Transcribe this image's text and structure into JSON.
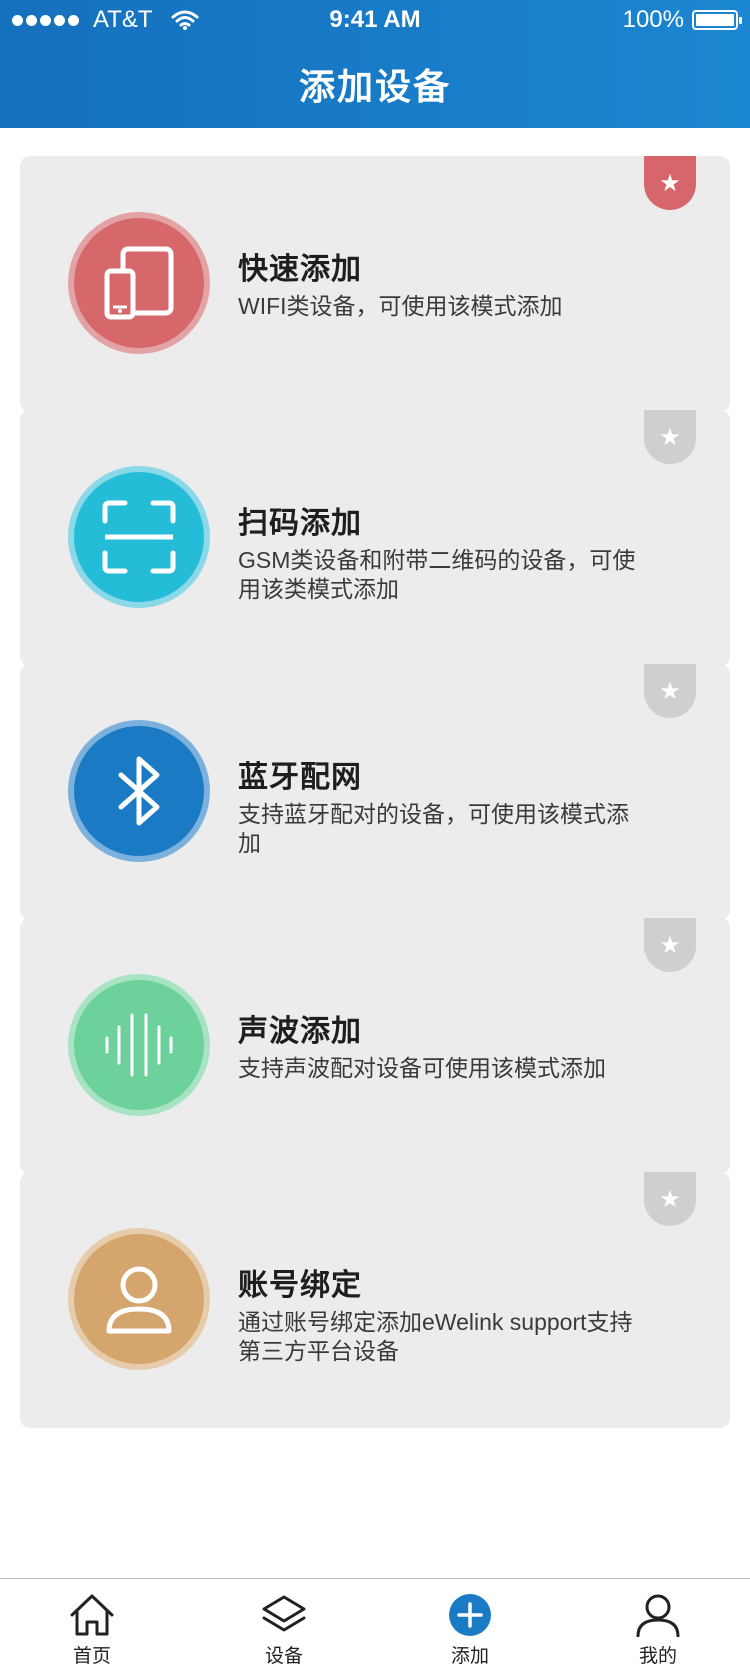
{
  "status_bar": {
    "carrier": "AT&T",
    "time": "9:41 AM",
    "battery": "100%"
  },
  "header": {
    "title": "添加设备"
  },
  "cards": [
    {
      "title": "快速添加",
      "description": "WIFI类设备，可使用该模式添加",
      "icon": "devices-icon",
      "color": "#d6686c",
      "starred": true
    },
    {
      "title": "扫码添加",
      "description": "GSM类设备和附带二维码的设备，可使用该类模式添加",
      "icon": "scan-icon",
      "color": "#25bcd8",
      "starred": false
    },
    {
      "title": "蓝牙配网",
      "description": "支持蓝牙配对的设备，可使用该模式添加",
      "icon": "bluetooth-icon",
      "color": "#1a7bc4",
      "starred": false
    },
    {
      "title": "声波添加",
      "description": "支持声波配对设备可使用该模式添加",
      "icon": "soundwave-icon",
      "color": "#6dd19b",
      "starred": false
    },
    {
      "title": "账号绑定",
      "description": "通过账号绑定添加eWelink support支持第三方平台设备",
      "icon": "user-icon",
      "color": "#d4a56c",
      "starred": false
    }
  ],
  "tabbar": {
    "items": [
      {
        "label": "首页",
        "icon": "home-icon"
      },
      {
        "label": "设备",
        "icon": "layers-icon"
      },
      {
        "label": "添加",
        "icon": "add-icon",
        "active": true
      },
      {
        "label": "我的",
        "icon": "profile-icon"
      }
    ]
  },
  "colors": {
    "header": "#1a7fc9",
    "card_bg": "#ececec",
    "ribbon_active": "#d6666b",
    "ribbon_inactive": "#cfcfcf"
  }
}
